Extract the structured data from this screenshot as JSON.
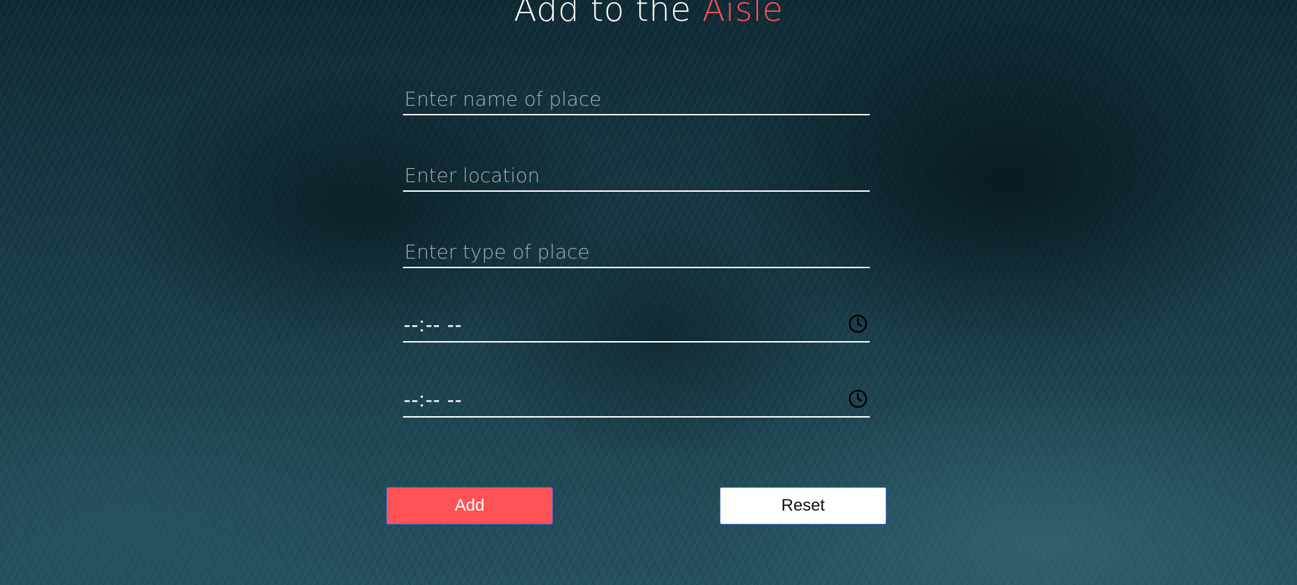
{
  "heading": {
    "text_main": "Add to the ",
    "text_accent": "Aisle",
    "accent_color": "#ff5257"
  },
  "form": {
    "name_field": {
      "placeholder": "Enter name of place",
      "value": ""
    },
    "location_field": {
      "placeholder": "Enter location",
      "value": ""
    },
    "type_field": {
      "placeholder": "Enter type of place",
      "value": ""
    },
    "start_time": {
      "display": "--:-- --",
      "icon": "clock-icon"
    },
    "end_time": {
      "display": "--:-- --",
      "icon": "clock-icon"
    }
  },
  "buttons": {
    "add_label": "Add",
    "reset_label": "Reset",
    "add_color": "#ff5257"
  }
}
